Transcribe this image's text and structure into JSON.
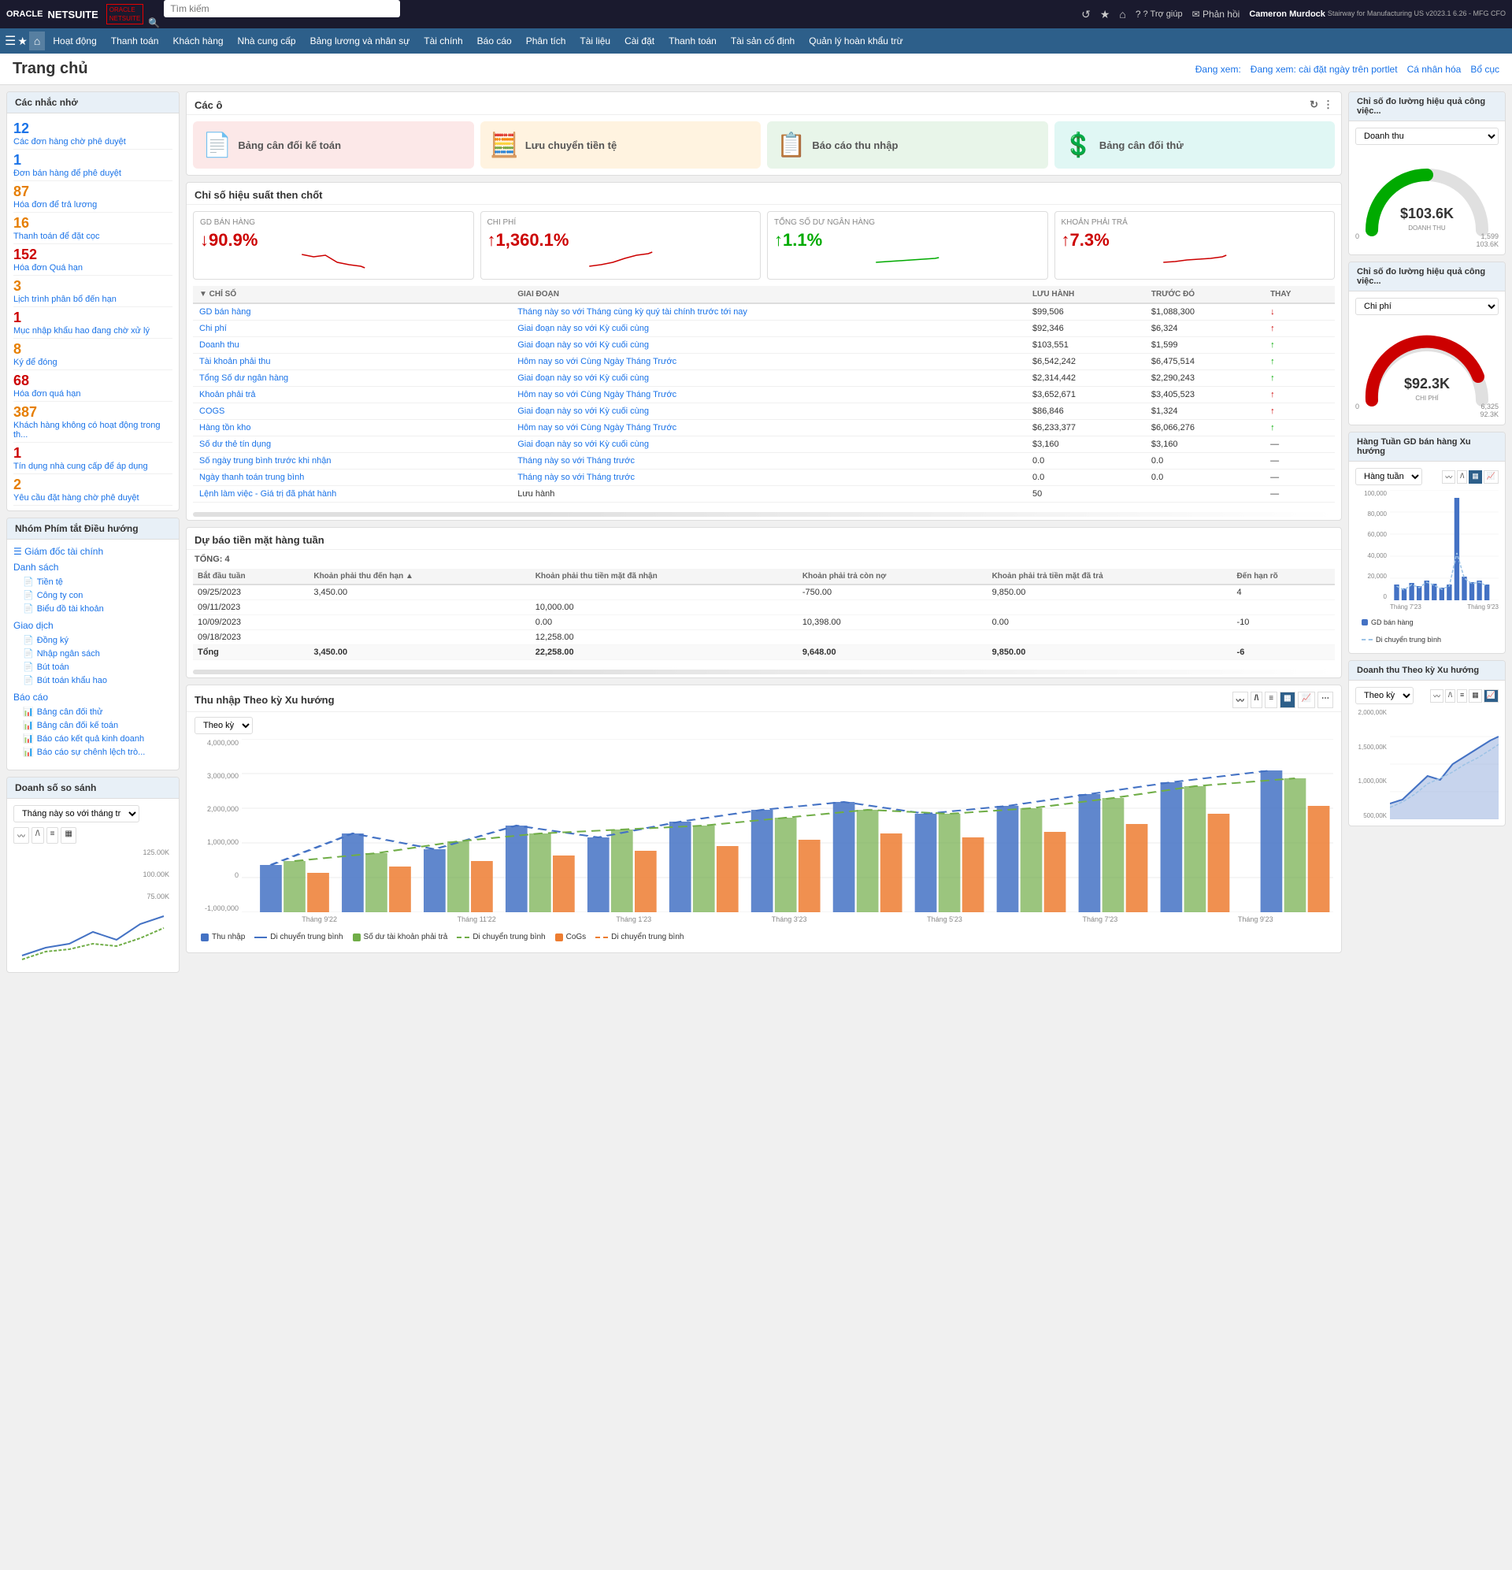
{
  "app": {
    "logo": "ORACLE NETSUITE",
    "logo_sub": "ORACLE NETSUITE",
    "search_placeholder": "Tìm kiếm"
  },
  "nav_icons": {
    "refresh": "↺",
    "support": "? Trợ giúp",
    "feedback": "✉ Phản hồi",
    "user": "Cameron Murdock",
    "user_sub": "Stairway for Manufacturing US v2023.1 6.26 - MFG CFO"
  },
  "menu": {
    "items": [
      "Hoạt động",
      "Thanh toán",
      "Khách hàng",
      "Nhà cung cấp",
      "Bảng lương và nhân sự",
      "Tài chính",
      "Báo cáo",
      "Phân tích",
      "Tài liệu",
      "Cài đặt",
      "Thanh toán",
      "Tài sản cố định",
      "Quản lý hoàn khẩu trừ"
    ]
  },
  "page": {
    "title": "Trang chủ",
    "viewing": "Đang xem: cài đặt ngày trên portlet",
    "personalize": "Cá nhân hóa",
    "layout": "Bổ cục"
  },
  "reminders": {
    "title": "Các nhắc nhở",
    "items": [
      {
        "num": "12",
        "label": "Các đơn hàng chờ phê duyệt",
        "color": "blue"
      },
      {
        "num": "1",
        "label": "Đơn bán hàng để phê duyệt",
        "color": "blue"
      },
      {
        "num": "87",
        "label": "Hóa đơn để trả lương",
        "color": "orange"
      },
      {
        "num": "16",
        "label": "Thanh toán để đặt cọc",
        "color": "orange"
      },
      {
        "num": "152",
        "label": "Hóa đơn Quá hạn",
        "color": "red"
      },
      {
        "num": "3",
        "label": "Lịch trình phân bổ đến hạn",
        "color": "orange"
      },
      {
        "num": "1",
        "label": "Mục nhập khẩu hao đang chờ xử lý",
        "color": "red"
      },
      {
        "num": "8",
        "label": "Ký để đóng",
        "color": "orange"
      },
      {
        "num": "68",
        "label": "Hóa đơn quá hạn",
        "color": "red"
      },
      {
        "num": "387",
        "label": "Khách hàng không có hoạt động trong th...",
        "color": "orange"
      },
      {
        "num": "1",
        "label": "Tín dụng nhà cung cấp để áp dụng",
        "color": "red"
      },
      {
        "num": "2",
        "label": "Yêu cầu đặt hàng chờ phê duyệt",
        "color": "orange"
      }
    ]
  },
  "shortcuts": {
    "title": "Nhóm Phím tắt Điều hướng",
    "finance_label": "Giám đốc tài chính",
    "list_label": "Danh sách",
    "list_items": [
      "Tiền tệ",
      "Công ty con",
      "Biểu đồ tài khoản"
    ],
    "transaction_label": "Giao dịch",
    "transaction_items": [
      "Đồng ký",
      "Nhập ngân sách",
      "Bút toán",
      "Bút toán khẩu hao"
    ],
    "report_label": "Báo cáo",
    "report_items": [
      "Bảng cân đối thử",
      "Bảng cân đối kế toán",
      "Báo cáo kết quả kinh doanh",
      "Báo cáo sự chênh lệch trò..."
    ]
  },
  "kpi_gauges": {
    "revenue_title": "Chỉ số đo lường hiệu quả công việc...",
    "revenue_select": "Doanh thu",
    "revenue_value": "$103.6K",
    "revenue_label": "DOANH THU",
    "revenue_max": "1,599",
    "revenue_min": "0",
    "revenue_current": "103.6K",
    "expense_title": "Chỉ số đo lường hiệu quả công việc...",
    "expense_select": "Chi phí",
    "expense_value": "$92.3K",
    "expense_label": "CHI PHÍ",
    "expense_max": "6,325",
    "expense_min": "0",
    "expense_current": "92.3K"
  },
  "tiles": {
    "section_title": "Các ô",
    "items": [
      {
        "label": "Bảng cân đối kế toán",
        "color": "pink",
        "icon": "📄"
      },
      {
        "label": "Lưu chuyển tiền tệ",
        "color": "orange",
        "icon": "🧮"
      },
      {
        "label": "Báo cáo thu nhập",
        "color": "green",
        "icon": "📋"
      },
      {
        "label": "Bảng cân đối thử",
        "color": "teal",
        "icon": "💲"
      }
    ]
  },
  "kpi_table": {
    "section_title": "Chỉ số hiệu suất then chốt",
    "summary_cards": [
      {
        "label": "GD BÁN HÀNG",
        "value": "↓90.9%",
        "trend": "down"
      },
      {
        "label": "CHI PHÍ",
        "value": "↑1,360.1%",
        "trend": "up"
      },
      {
        "label": "TỔNG SỐ DƯ NGÂN HÀNG",
        "value": "↑1.1%",
        "trend": "up_green"
      },
      {
        "label": "KHOẢN PHẢI TRẢ",
        "value": "↑7.3%",
        "trend": "up"
      }
    ],
    "columns": [
      "CHỈ SỐ",
      "GIAI ĐOẠN",
      "LƯU HÀNH",
      "TRƯỚC ĐÓ",
      "THAY"
    ],
    "rows": [
      {
        "name": "GD bán hàng",
        "period": "Tháng này so với Tháng cùng kỳ quý tài chính trước tới nay",
        "current": "$99,506",
        "previous": "$1,088,300",
        "change": "down"
      },
      {
        "name": "Chi phí",
        "period": "Giai đoạn này so với Kỳ cuối cùng",
        "current": "$92,346",
        "previous": "$6,324",
        "change": "up"
      },
      {
        "name": "Doanh thu",
        "period": "Giai đoạn này so với Kỳ cuối cùng",
        "current": "$103,551",
        "previous": "$1,599",
        "change": "up"
      },
      {
        "name": "Tài khoản phải thu",
        "period": "Hôm nay so với Cùng Ngày Tháng Trước",
        "current": "$6,542,242",
        "previous": "$6,475,514",
        "change": "up"
      },
      {
        "name": "Tổng Số dư ngân hàng",
        "period": "Giai đoạn này so với Kỳ cuối cùng",
        "current": "$2,314,442",
        "previous": "$2,290,243",
        "change": "up"
      },
      {
        "name": "Khoản phải trả",
        "period": "Hôm nay so với Cùng Ngày Tháng Trước",
        "current": "$3,652,671",
        "previous": "$3,405,523",
        "change": "up"
      },
      {
        "name": "COGS",
        "period": "Giai đoạn này so với Kỳ cuối cùng",
        "current": "$86,846",
        "previous": "$1,324",
        "change": "up"
      },
      {
        "name": "Hàng tồn kho",
        "period": "Hôm nay so với Cùng Ngày Tháng Trước",
        "current": "$6,233,377",
        "previous": "$6,066,276",
        "change": "up"
      },
      {
        "name": "Số dư thẻ tín dụng",
        "period": "Giai đoạn này so với Kỳ cuối cùng",
        "current": "$3,160",
        "previous": "$3,160",
        "change": "neutral"
      },
      {
        "name": "Số ngày trung bình trước khi nhận",
        "period": "Tháng này so với Tháng trước",
        "current": "0.0",
        "previous": "0.0",
        "change": "neutral"
      },
      {
        "name": "Ngày thanh toán trung bình",
        "period": "Tháng này so với Tháng trước",
        "current": "0.0",
        "previous": "0.0",
        "change": "neutral"
      },
      {
        "name": "Lệnh làm việc - Giá trị đã phát hành",
        "period": "Lưu hành",
        "current": "50",
        "previous": "",
        "change": "neutral"
      }
    ]
  },
  "forecast": {
    "title": "Dự báo tiền mặt hàng tuần",
    "total_label": "TỔNG: 4",
    "columns": [
      "Bắt đầu tuần",
      "Khoản phải thu đến hạn ▲",
      "Khoản phải thu tiền mặt đã nhận",
      "Khoản phải trả còn nợ",
      "Khoản phải trả tiền mặt đã trả",
      "Đến hạn rõ"
    ],
    "rows": [
      {
        "date": "09/25/2023",
        "ar_due": "3,450.00",
        "ar_received": "",
        "ap_owed": "-750.00",
        "ap_paid": "9,850.00",
        "net": "4"
      },
      {
        "date": "09/11/2023",
        "ar_due": "",
        "ar_received": "10,000.00",
        "ap_owed": "",
        "ap_paid": "",
        "net": ""
      },
      {
        "date": "10/09/2023",
        "ar_due": "",
        "ar_received": "0.00",
        "ap_owed": "10,398.00",
        "ap_paid": "0.00",
        "net": "-10"
      },
      {
        "date": "09/18/2023",
        "ar_due": "",
        "ar_received": "12,258.00",
        "ap_owed": "",
        "ap_paid": "",
        "net": ""
      }
    ],
    "total_row": {
      "label": "Tổng",
      "ar_due": "3,450.00",
      "ar_received": "22,258.00",
      "ap_owed": "9,648.00",
      "ap_paid": "9,850.00",
      "net": "-6"
    }
  },
  "income_trend": {
    "title": "Thu nhập Theo kỳ Xu hướng",
    "select": "Theo kỳ",
    "legend": [
      {
        "label": "Thu nhập",
        "color": "#4472c4",
        "type": "bar"
      },
      {
        "label": "Di chuyển trung bình",
        "color": "#4472c4",
        "type": "line"
      },
      {
        "label": "Số dư tài khoản phải trả",
        "color": "#70ad47",
        "type": "bar"
      },
      {
        "label": "Di chuyển trung bình",
        "color": "#70ad47",
        "type": "line"
      },
      {
        "label": "COGS",
        "color": "#ed7d31",
        "type": "bar"
      },
      {
        "label": "Di chuyển trung bình",
        "color": "#ed7d31",
        "type": "line"
      }
    ],
    "x_labels": [
      "Tháng 9'22",
      "Tháng 11'22",
      "Tháng 1'23",
      "Tháng 3'23",
      "Tháng 5'23",
      "Tháng 7'23",
      "Tháng 9'23"
    ],
    "y_labels": [
      "-1,000,000",
      "0",
      "1,000,000",
      "2,000,000",
      "3,000,000",
      "4,000,000"
    ]
  },
  "sales_trend": {
    "title": "Hàng Tuần GD bán hàng Xu hướng",
    "select": "Hàng tuần",
    "legend": [
      {
        "label": "GD bán hàng",
        "color": "#4472c4"
      },
      {
        "label": "Di chuyển trung bình",
        "color": "#9dc3e6"
      }
    ],
    "y_labels": [
      "0",
      "20,000",
      "40,000",
      "60,000",
      "80,000",
      "100,000"
    ],
    "x_labels": [
      "Tháng 7'23",
      "Tháng 9'23"
    ]
  },
  "revenue_trend": {
    "title": "Doanh thu Theo kỳ Xu hướng",
    "select": "Theo kỳ",
    "y_labels": [
      "500,00K",
      "1,000,00K",
      "1,500,00K",
      "2,000,00K"
    ],
    "x_labels": []
  },
  "comparison": {
    "title": "Doanh số so sánh",
    "select": "Tháng này so với tháng trước",
    "y_labels": [
      "75.00K",
      "100.00K",
      "125.00K"
    ]
  }
}
